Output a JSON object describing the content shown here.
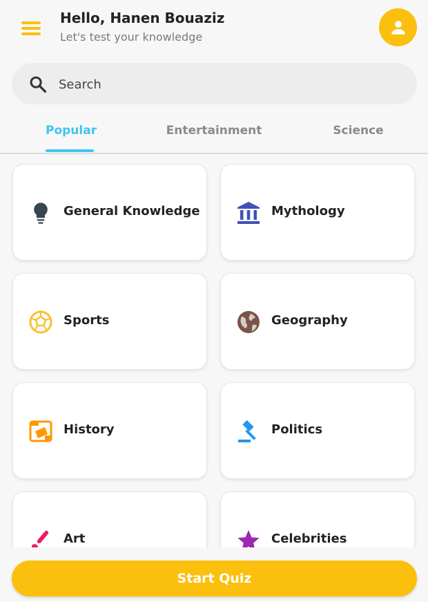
{
  "header": {
    "greeting": "Hello, Hanen Bouaziz",
    "subtitle": "Let's test your knowledge"
  },
  "search": {
    "placeholder": "Search"
  },
  "tabs": [
    {
      "label": "Popular",
      "active": true
    },
    {
      "label": "Entertainment",
      "active": false
    },
    {
      "label": "Science",
      "active": false
    }
  ],
  "categories": [
    {
      "label": "General Knowledge",
      "icon": "lightbulb-icon",
      "color": "#37474f"
    },
    {
      "label": "Mythology",
      "icon": "bank-icon",
      "color": "#3f51b5"
    },
    {
      "label": "Sports",
      "icon": "soccer-ball-icon",
      "color": "#fbc02d"
    },
    {
      "label": "Geography",
      "icon": "globe-icon",
      "color": "#795548"
    },
    {
      "label": "History",
      "icon": "history-icon",
      "color": "#ff9800"
    },
    {
      "label": "Politics",
      "icon": "gavel-icon",
      "color": "#2196f3"
    },
    {
      "label": "Art",
      "icon": "brush-icon",
      "color": "#e91e63"
    },
    {
      "label": "Celebrities",
      "icon": "star-icon",
      "color": "#9c27b0"
    }
  ],
  "footer": {
    "start_label": "Start Quiz"
  },
  "colors": {
    "accent": "#fbbf0d",
    "tab_active": "#3ec4f2"
  }
}
